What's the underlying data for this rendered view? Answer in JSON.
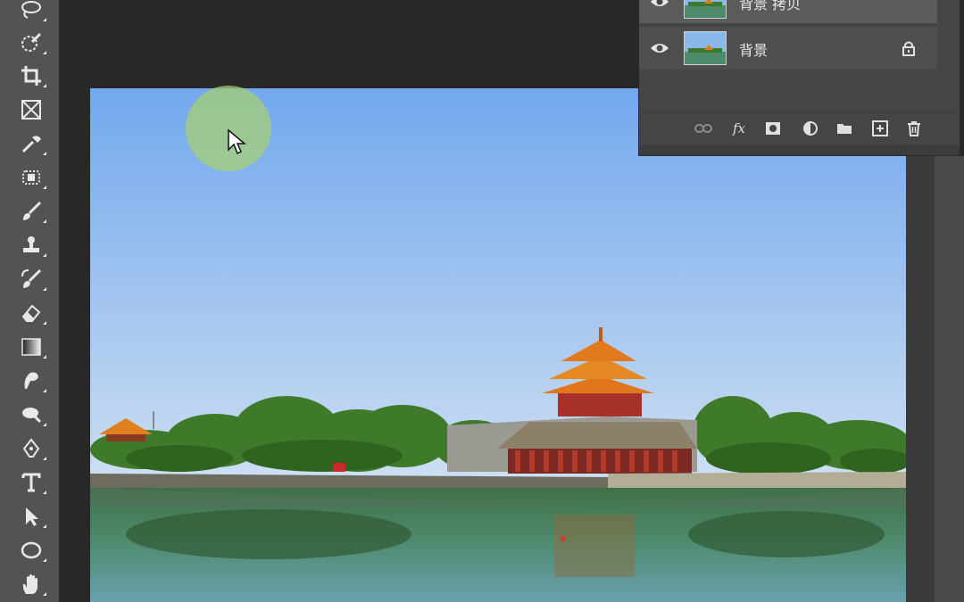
{
  "app": "Photoshop",
  "colors": {
    "toolbar_bg": "#535353",
    "workspace_bg": "#282828",
    "panel_bg": "#454545",
    "sky_top": "#72a8ee",
    "sky_bottom": "#c6dcf4",
    "roof_orange": "#e07a20",
    "wall_red": "#b53a2a",
    "water": "#4b8a78"
  },
  "toolbar": {
    "tools": [
      {
        "name": "lasso-tool",
        "icon": "lasso-icon"
      },
      {
        "name": "quick-selection-tool",
        "icon": "quick-selection-icon"
      },
      {
        "name": "crop-tool",
        "icon": "crop-icon"
      },
      {
        "name": "frame-tool",
        "icon": "frame-icon"
      },
      {
        "name": "eyedropper-tool",
        "icon": "eyedropper-icon"
      },
      {
        "name": "healing-brush-tool",
        "icon": "healing-brush-icon"
      },
      {
        "name": "brush-tool",
        "icon": "brush-icon"
      },
      {
        "name": "clone-stamp-tool",
        "icon": "stamp-icon"
      },
      {
        "name": "history-brush-tool",
        "icon": "history-brush-icon"
      },
      {
        "name": "eraser-tool",
        "icon": "eraser-icon"
      },
      {
        "name": "gradient-tool",
        "icon": "gradient-icon"
      },
      {
        "name": "smudge-tool",
        "icon": "smudge-icon"
      },
      {
        "name": "dodge-tool",
        "icon": "dodge-icon"
      },
      {
        "name": "pen-tool",
        "icon": "pen-icon"
      },
      {
        "name": "type-tool",
        "icon": "type-icon",
        "glyph": "T"
      },
      {
        "name": "path-selection-tool",
        "icon": "arrow-icon"
      },
      {
        "name": "ellipse-tool",
        "icon": "ellipse-icon"
      },
      {
        "name": "hand-tool",
        "icon": "hand-icon"
      }
    ]
  },
  "layers_panel": {
    "layers": [
      {
        "name": "背景 拷贝",
        "visible": true,
        "selected": true,
        "locked": false
      },
      {
        "name": "背景",
        "visible": true,
        "selected": false,
        "locked": true
      }
    ],
    "footer_buttons": [
      {
        "name": "link-layers",
        "icon": "link-icon"
      },
      {
        "name": "layer-style",
        "icon": "fx-icon",
        "glyph": "fx"
      },
      {
        "name": "add-mask",
        "icon": "mask-icon"
      },
      {
        "name": "adjustment-layer",
        "icon": "adjustment-icon"
      },
      {
        "name": "new-group",
        "icon": "folder-icon"
      },
      {
        "name": "new-layer",
        "icon": "new-layer-icon"
      },
      {
        "name": "delete-layer",
        "icon": "trash-icon"
      }
    ]
  }
}
